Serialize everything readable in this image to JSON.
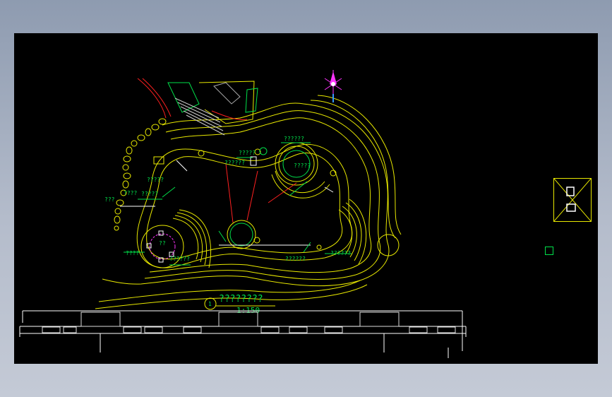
{
  "drawing": {
    "title": "????????",
    "scale": "1:150",
    "callout_number": "1",
    "labels": {
      "circle_top": "??????",
      "top_mid": "?????",
      "top_center": "??????",
      "circle_right": "?????",
      "left_far": "???",
      "left_a": "????",
      "left_b": "?????",
      "left_c": "?????",
      "fountain_label": "??",
      "bottom_left": "??????",
      "right_low": "??????",
      "right_arc": "??????",
      "left_down": "????"
    }
  },
  "colors": {
    "background": "#000000",
    "main_line": "#e8e800",
    "accent_green": "#00e04a",
    "red": "#ff2020",
    "white": "#ffffff",
    "magenta": "#ff33ff"
  },
  "icons": {
    "north_arrow": "north-arrow-icon",
    "view_cube": "view-cube-icon"
  }
}
